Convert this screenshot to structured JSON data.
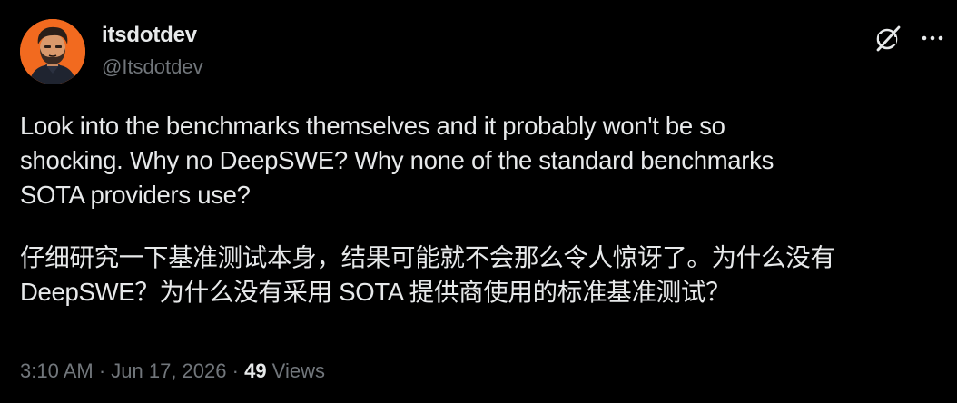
{
  "author": {
    "display_name": "itsdotdev",
    "handle": "@Itsdotdev",
    "avatar_icon": "cartoon-man-avatar-icon",
    "avatar_bg": "#f26a1f"
  },
  "header_actions": {
    "grok_icon": "grok-icon",
    "more_icon": "more-horizontal-icon"
  },
  "tweet": {
    "text_en": "Look into the benchmarks themselves and it probably won't be so\nshocking. Why no DeepSWE? Why none of the standard benchmarks\nSOTA providers use?",
    "text_zh": "仔细研究一下基准测试本身，结果可能就不会那么令人惊讶了。为什么没有\nDeepSWE？为什么没有采用 SOTA 提供商使用的标准基准测试？"
  },
  "meta": {
    "time": "3:10 AM",
    "sep1": " · ",
    "date": "Jun 17, 2026",
    "sep2": " · ",
    "views_count": "49",
    "views_label": " Views"
  },
  "colors": {
    "background": "#000000",
    "primary_text": "#e7e9ea",
    "secondary_text": "#71767b"
  }
}
